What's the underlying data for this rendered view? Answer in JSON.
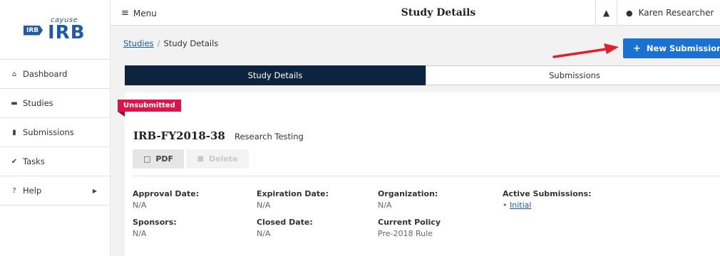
{
  "app": {
    "logo_small": "cayuse",
    "logo_tag": "IRB",
    "logo_big": "IRB"
  },
  "sidebar": {
    "items": [
      {
        "label": "Dashboard",
        "icon": "home-icon"
      },
      {
        "label": "Studies",
        "icon": "folder-icon"
      },
      {
        "label": "Submissions",
        "icon": "document-icon"
      },
      {
        "label": "Tasks",
        "icon": "checkmark-icon"
      },
      {
        "label": "Help",
        "icon": "question-icon"
      }
    ]
  },
  "topbar": {
    "menu_label": "Menu",
    "title": "Study Details",
    "user_name": "Karen Researcher"
  },
  "breadcrumb": {
    "studies": "Studies",
    "sep": "/",
    "current": "Study Details"
  },
  "actions": {
    "new_submission": "New Submission"
  },
  "tabs": [
    {
      "label": "Study Details",
      "active": true
    },
    {
      "label": "Submissions",
      "active": false
    }
  ],
  "study": {
    "status": "Unsubmitted",
    "id": "IRB-FY2018-38",
    "title": "Research Testing",
    "pdf_label": "PDF",
    "delete_label": "Delete"
  },
  "fields": {
    "approval_date": {
      "label": "Approval Date:",
      "value": "N/A"
    },
    "expiration_date": {
      "label": "Expiration Date:",
      "value": "N/A"
    },
    "organization": {
      "label": "Organization:",
      "value": "N/A"
    },
    "active_submissions": {
      "label": "Active Submissions:",
      "items": [
        "Initial"
      ]
    },
    "sponsors": {
      "label": "Sponsors:",
      "value": "N/A"
    },
    "closed_date": {
      "label": "Closed Date:",
      "value": "N/A"
    },
    "current_policy": {
      "label": "Current Policy",
      "value": "Pre-2018 Rule"
    }
  },
  "colors": {
    "brand": "#1f5aa6",
    "primary_button": "#1b71d1",
    "active_tab": "#0c2440",
    "status_badge": "#e0124b",
    "annotation_arrow": "#e0202a"
  }
}
